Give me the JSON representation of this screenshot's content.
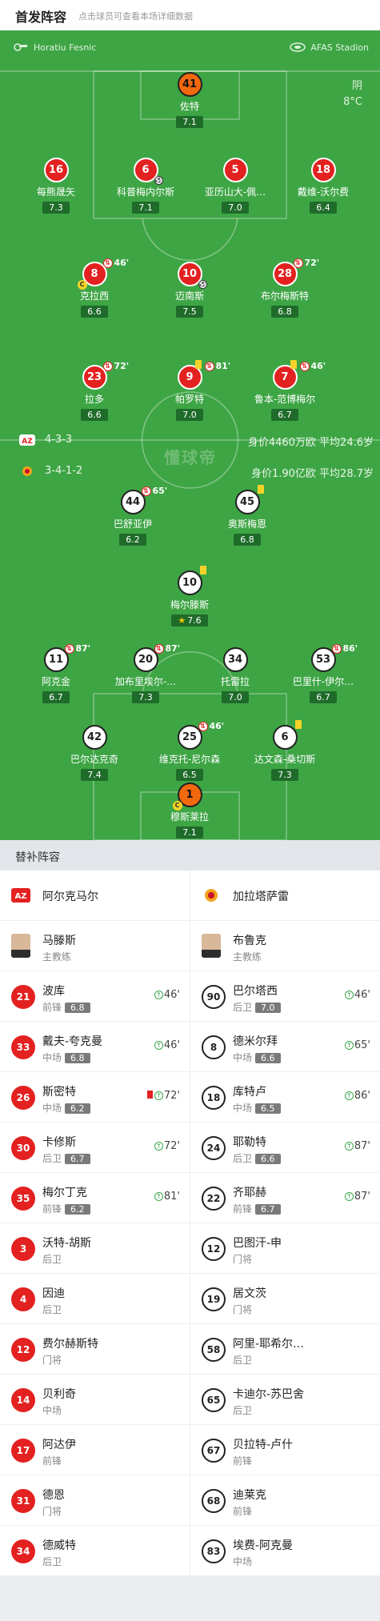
{
  "header": {
    "title": "首发阵容",
    "hint": "点击球员可查看本场详细数据"
  },
  "pitch": {
    "referee": "Horatiu Fesnic",
    "stadium": "AFAS Stadion",
    "weather": "阴",
    "temperature": "8°C",
    "watermark": "懂球帝",
    "home_team": {
      "formation": "4-3-3",
      "stats": "身价4460万欧  平均24.6岁"
    },
    "away_team": {
      "formation": "3-4-1-2",
      "stats": "身价1.90亿欧  平均28.7岁"
    },
    "home_players": [
      {
        "num": "41",
        "name": "佐特",
        "rating": "7.1"
      },
      {
        "num": "16",
        "name": "每熊晟矢",
        "rating": "7.3"
      },
      {
        "num": "6",
        "name": "科普梅内尔斯",
        "rating": "7.1"
      },
      {
        "num": "5",
        "name": "亚历山大-佩…",
        "rating": "7.0"
      },
      {
        "num": "18",
        "name": "戴维-沃尔费",
        "rating": "6.4"
      },
      {
        "num": "8",
        "name": "克拉西",
        "rating": "6.6",
        "sub": "46'"
      },
      {
        "num": "10",
        "name": "迈南斯",
        "rating": "7.5"
      },
      {
        "num": "28",
        "name": "布尔梅斯特",
        "rating": "6.8",
        "sub": "72'"
      },
      {
        "num": "23",
        "name": "拉多",
        "rating": "6.6",
        "sub": "72'"
      },
      {
        "num": "9",
        "name": "帕罗特",
        "rating": "7.0",
        "sub": "81'"
      },
      {
        "num": "7",
        "name": "鲁本-范博梅尔",
        "rating": "6.7",
        "sub": "46'"
      }
    ],
    "away_players": [
      {
        "num": "44",
        "name": "巴舒亚伊",
        "rating": "6.2",
        "sub": "65'"
      },
      {
        "num": "45",
        "name": "奥斯梅恩",
        "rating": "6.8"
      },
      {
        "num": "10",
        "name": "梅尔滕斯",
        "rating": "7.6"
      },
      {
        "num": "11",
        "name": "阿克金",
        "rating": "6.7",
        "sub": "87'"
      },
      {
        "num": "20",
        "name": "加布里埃尔-…",
        "rating": "7.3",
        "sub": "87'"
      },
      {
        "num": "34",
        "name": "托雷拉",
        "rating": "7.0"
      },
      {
        "num": "53",
        "name": "巴里什-伊尔…",
        "rating": "6.7",
        "sub": "86'"
      },
      {
        "num": "42",
        "name": "巴尔达克奇",
        "rating": "7.4"
      },
      {
        "num": "25",
        "name": "维克托-尼尔森",
        "rating": "6.5",
        "sub": "46'"
      },
      {
        "num": "6",
        "name": "达文森-桑切斯",
        "rating": "7.3"
      },
      {
        "num": "1",
        "name": "穆斯莱拉",
        "rating": "7.1"
      }
    ]
  },
  "subs": {
    "title": "替补阵容",
    "home_team": "阿尔克马尔",
    "away_team": "加拉塔萨雷",
    "home_coach": {
      "name": "马滕斯",
      "role": "主教练"
    },
    "away_coach": {
      "name": "布鲁克",
      "role": "主教练"
    },
    "home": [
      {
        "num": "21",
        "name": "波库",
        "pos": "前锋",
        "rating": "6.8",
        "min": "46'"
      },
      {
        "num": "33",
        "name": "戴夫-夸克曼",
        "pos": "中场",
        "rating": "6.8",
        "min": "46'"
      },
      {
        "num": "26",
        "name": "斯密特",
        "pos": "中场",
        "rating": "6.2",
        "min": "72'"
      },
      {
        "num": "30",
        "name": "卡修斯",
        "pos": "后卫",
        "rating": "6.7",
        "min": "72'"
      },
      {
        "num": "35",
        "name": "梅尔丁克",
        "pos": "前锋",
        "rating": "6.2",
        "min": "81'"
      },
      {
        "num": "3",
        "name": "沃特-胡斯",
        "pos": "后卫"
      },
      {
        "num": "4",
        "name": "因迪",
        "pos": "后卫"
      },
      {
        "num": "12",
        "name": "费尔赫斯特",
        "pos": "门将"
      },
      {
        "num": "14",
        "name": "贝利奇",
        "pos": "中场"
      },
      {
        "num": "17",
        "name": "阿达伊",
        "pos": "前锋"
      },
      {
        "num": "31",
        "name": "德恩",
        "pos": "门将"
      },
      {
        "num": "34",
        "name": "德威特",
        "pos": "后卫"
      }
    ],
    "away": [
      {
        "num": "90",
        "name": "巴尔塔西",
        "pos": "后卫",
        "rating": "7.0",
        "min": "46'"
      },
      {
        "num": "8",
        "name": "德米尔拜",
        "pos": "中场",
        "rating": "6.6",
        "min": "65'"
      },
      {
        "num": "18",
        "name": "库特卢",
        "pos": "中场",
        "rating": "6.5",
        "min": "86'"
      },
      {
        "num": "24",
        "name": "耶勒特",
        "pos": "后卫",
        "rating": "6.6",
        "min": "87'"
      },
      {
        "num": "22",
        "name": "齐耶赫",
        "pos": "前锋",
        "rating": "6.7",
        "min": "87'"
      },
      {
        "num": "12",
        "name": "巴图汗-申",
        "pos": "门将"
      },
      {
        "num": "19",
        "name": "居文茨",
        "pos": "门将"
      },
      {
        "num": "58",
        "name": "阿里-耶希尔…",
        "pos": "后卫"
      },
      {
        "num": "65",
        "name": "卡迪尔-苏巴舍",
        "pos": "后卫"
      },
      {
        "num": "67",
        "name": "贝拉特-卢什",
        "pos": "前锋"
      },
      {
        "num": "68",
        "name": "迪莱克",
        "pos": "前锋"
      },
      {
        "num": "83",
        "name": "埃费-阿克曼",
        "pos": "中场"
      }
    ]
  },
  "colors": {
    "pitch": "#3ea545",
    "home": "#e32120",
    "away": "#ffffff",
    "keeper": "#f2680c"
  }
}
